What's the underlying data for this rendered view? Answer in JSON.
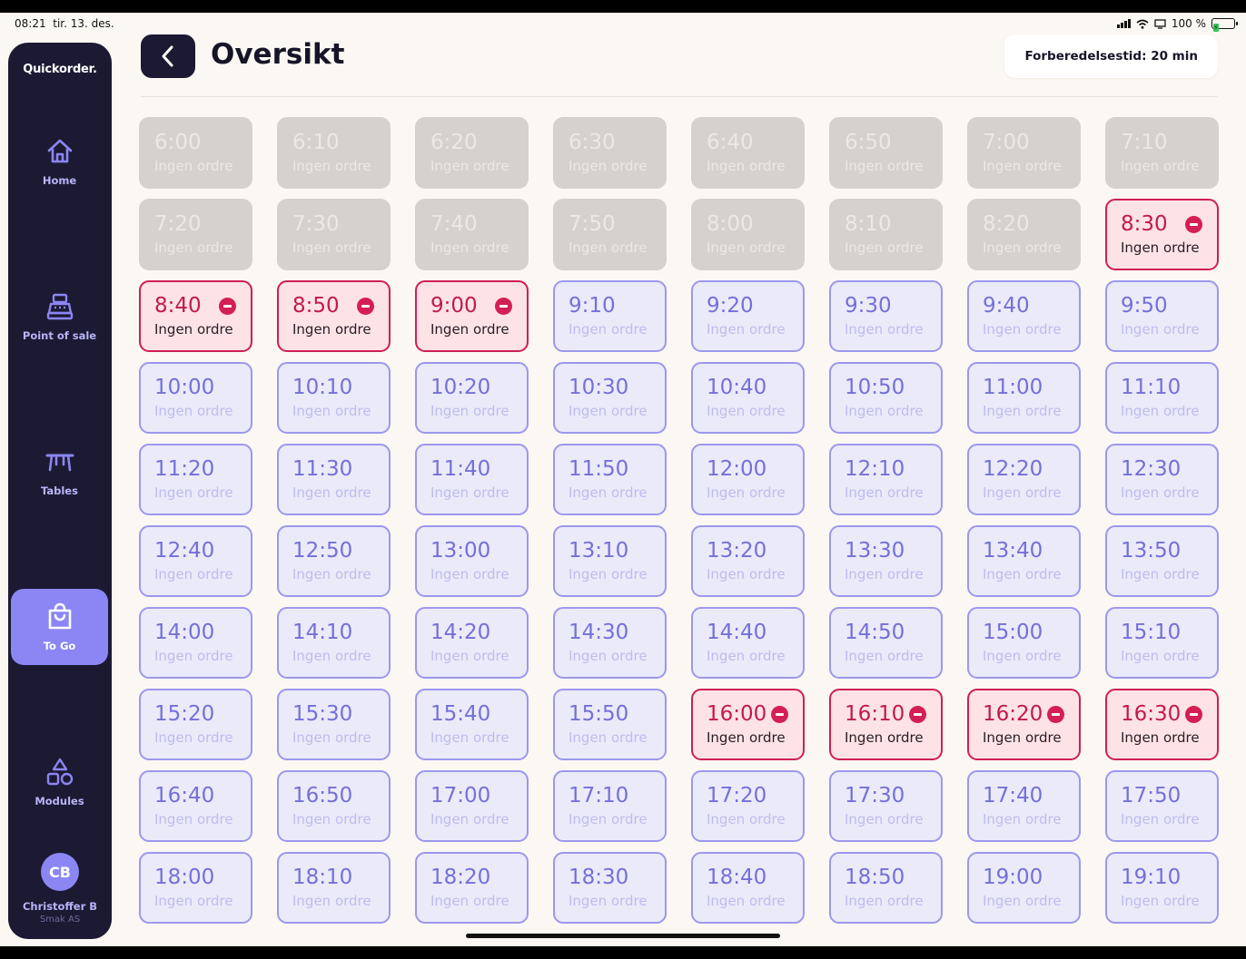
{
  "status_bar": {
    "time": "08:21",
    "date": "tir. 13. des.",
    "battery": "100 %"
  },
  "sidebar": {
    "logo": "Quickorder.",
    "items": [
      {
        "label": "Home",
        "icon": "home-icon",
        "active": false
      },
      {
        "label": "Point of sale",
        "icon": "cash-register-icon",
        "active": false
      },
      {
        "label": "Tables",
        "icon": "table-icon",
        "active": false
      },
      {
        "label": "To Go",
        "icon": "shopping-bag-icon",
        "active": true
      },
      {
        "label": "Modules",
        "icon": "modules-icon",
        "active": false
      }
    ],
    "user": {
      "initials": "CB",
      "name": "Christoffer B",
      "org": "Smak AS"
    }
  },
  "header": {
    "title": "Oversikt",
    "prep_time": "Forberedelsestid: 20 min"
  },
  "colors": {
    "accent": "#8b86f3",
    "sidebar_bg": "#1c1a33",
    "blocked": "#d41f54",
    "open_border": "#9c97ee",
    "past_bg": "#d5d1ce"
  },
  "slots": [
    {
      "time": "6:00",
      "label": "Ingen ordre",
      "state": "past"
    },
    {
      "time": "6:10",
      "label": "Ingen ordre",
      "state": "past"
    },
    {
      "time": "6:20",
      "label": "Ingen ordre",
      "state": "past"
    },
    {
      "time": "6:30",
      "label": "Ingen ordre",
      "state": "past"
    },
    {
      "time": "6:40",
      "label": "Ingen ordre",
      "state": "past"
    },
    {
      "time": "6:50",
      "label": "Ingen ordre",
      "state": "past"
    },
    {
      "time": "7:00",
      "label": "Ingen ordre",
      "state": "past"
    },
    {
      "time": "7:10",
      "label": "Ingen ordre",
      "state": "past"
    },
    {
      "time": "7:20",
      "label": "Ingen ordre",
      "state": "past"
    },
    {
      "time": "7:30",
      "label": "Ingen ordre",
      "state": "past"
    },
    {
      "time": "7:40",
      "label": "Ingen ordre",
      "state": "past"
    },
    {
      "time": "7:50",
      "label": "Ingen ordre",
      "state": "past"
    },
    {
      "time": "8:00",
      "label": "Ingen ordre",
      "state": "past"
    },
    {
      "time": "8:10",
      "label": "Ingen ordre",
      "state": "past"
    },
    {
      "time": "8:20",
      "label": "Ingen ordre",
      "state": "past"
    },
    {
      "time": "8:30",
      "label": "Ingen ordre",
      "state": "blocked"
    },
    {
      "time": "8:40",
      "label": "Ingen ordre",
      "state": "blocked"
    },
    {
      "time": "8:50",
      "label": "Ingen ordre",
      "state": "blocked"
    },
    {
      "time": "9:00",
      "label": "Ingen ordre",
      "state": "blocked"
    },
    {
      "time": "9:10",
      "label": "Ingen ordre",
      "state": "open"
    },
    {
      "time": "9:20",
      "label": "Ingen ordre",
      "state": "open"
    },
    {
      "time": "9:30",
      "label": "Ingen ordre",
      "state": "open"
    },
    {
      "time": "9:40",
      "label": "Ingen ordre",
      "state": "open"
    },
    {
      "time": "9:50",
      "label": "Ingen ordre",
      "state": "open"
    },
    {
      "time": "10:00",
      "label": "Ingen ordre",
      "state": "open"
    },
    {
      "time": "10:10",
      "label": "Ingen ordre",
      "state": "open"
    },
    {
      "time": "10:20",
      "label": "Ingen ordre",
      "state": "open"
    },
    {
      "time": "10:30",
      "label": "Ingen ordre",
      "state": "open"
    },
    {
      "time": "10:40",
      "label": "Ingen ordre",
      "state": "open"
    },
    {
      "time": "10:50",
      "label": "Ingen ordre",
      "state": "open"
    },
    {
      "time": "11:00",
      "label": "Ingen ordre",
      "state": "open"
    },
    {
      "time": "11:10",
      "label": "Ingen ordre",
      "state": "open"
    },
    {
      "time": "11:20",
      "label": "Ingen ordre",
      "state": "open"
    },
    {
      "time": "11:30",
      "label": "Ingen ordre",
      "state": "open"
    },
    {
      "time": "11:40",
      "label": "Ingen ordre",
      "state": "open"
    },
    {
      "time": "11:50",
      "label": "Ingen ordre",
      "state": "open"
    },
    {
      "time": "12:00",
      "label": "Ingen ordre",
      "state": "open"
    },
    {
      "time": "12:10",
      "label": "Ingen ordre",
      "state": "open"
    },
    {
      "time": "12:20",
      "label": "Ingen ordre",
      "state": "open"
    },
    {
      "time": "12:30",
      "label": "Ingen ordre",
      "state": "open"
    },
    {
      "time": "12:40",
      "label": "Ingen ordre",
      "state": "open"
    },
    {
      "time": "12:50",
      "label": "Ingen ordre",
      "state": "open"
    },
    {
      "time": "13:00",
      "label": "Ingen ordre",
      "state": "open"
    },
    {
      "time": "13:10",
      "label": "Ingen ordre",
      "state": "open"
    },
    {
      "time": "13:20",
      "label": "Ingen ordre",
      "state": "open"
    },
    {
      "time": "13:30",
      "label": "Ingen ordre",
      "state": "open"
    },
    {
      "time": "13:40",
      "label": "Ingen ordre",
      "state": "open"
    },
    {
      "time": "13:50",
      "label": "Ingen ordre",
      "state": "open"
    },
    {
      "time": "14:00",
      "label": "Ingen ordre",
      "state": "open"
    },
    {
      "time": "14:10",
      "label": "Ingen ordre",
      "state": "open"
    },
    {
      "time": "14:20",
      "label": "Ingen ordre",
      "state": "open"
    },
    {
      "time": "14:30",
      "label": "Ingen ordre",
      "state": "open"
    },
    {
      "time": "14:40",
      "label": "Ingen ordre",
      "state": "open"
    },
    {
      "time": "14:50",
      "label": "Ingen ordre",
      "state": "open"
    },
    {
      "time": "15:00",
      "label": "Ingen ordre",
      "state": "open"
    },
    {
      "time": "15:10",
      "label": "Ingen ordre",
      "state": "open"
    },
    {
      "time": "15:20",
      "label": "Ingen ordre",
      "state": "open"
    },
    {
      "time": "15:30",
      "label": "Ingen ordre",
      "state": "open"
    },
    {
      "time": "15:40",
      "label": "Ingen ordre",
      "state": "open"
    },
    {
      "time": "15:50",
      "label": "Ingen ordre",
      "state": "open"
    },
    {
      "time": "16:00",
      "label": "Ingen ordre",
      "state": "blocked"
    },
    {
      "time": "16:10",
      "label": "Ingen ordre",
      "state": "blocked"
    },
    {
      "time": "16:20",
      "label": "Ingen ordre",
      "state": "blocked"
    },
    {
      "time": "16:30",
      "label": "Ingen ordre",
      "state": "blocked"
    },
    {
      "time": "16:40",
      "label": "Ingen ordre",
      "state": "open"
    },
    {
      "time": "16:50",
      "label": "Ingen ordre",
      "state": "open"
    },
    {
      "time": "17:00",
      "label": "Ingen ordre",
      "state": "open"
    },
    {
      "time": "17:10",
      "label": "Ingen ordre",
      "state": "open"
    },
    {
      "time": "17:20",
      "label": "Ingen ordre",
      "state": "open"
    },
    {
      "time": "17:30",
      "label": "Ingen ordre",
      "state": "open"
    },
    {
      "time": "17:40",
      "label": "Ingen ordre",
      "state": "open"
    },
    {
      "time": "17:50",
      "label": "Ingen ordre",
      "state": "open"
    },
    {
      "time": "18:00",
      "label": "Ingen ordre",
      "state": "open"
    },
    {
      "time": "18:10",
      "label": "Ingen ordre",
      "state": "open"
    },
    {
      "time": "18:20",
      "label": "Ingen ordre",
      "state": "open"
    },
    {
      "time": "18:30",
      "label": "Ingen ordre",
      "state": "open"
    },
    {
      "time": "18:40",
      "label": "Ingen ordre",
      "state": "open"
    },
    {
      "time": "18:50",
      "label": "Ingen ordre",
      "state": "open"
    },
    {
      "time": "19:00",
      "label": "Ingen ordre",
      "state": "open"
    },
    {
      "time": "19:10",
      "label": "Ingen ordre",
      "state": "open"
    }
  ]
}
